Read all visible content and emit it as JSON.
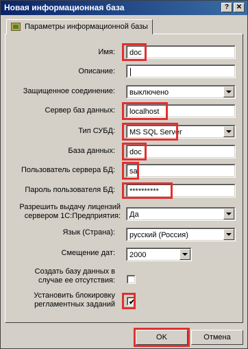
{
  "window": {
    "title": "Новая информационная база",
    "help": "?",
    "close": "✕"
  },
  "tab": {
    "label": "Параметры информационной базы"
  },
  "form": {
    "name": {
      "label": "Имя:",
      "value": "doc"
    },
    "description": {
      "label": "Описание:",
      "value": ""
    },
    "secure_connection": {
      "label": "Защищенное соединение:",
      "value": "выключено"
    },
    "db_server": {
      "label": "Сервер баз данных:",
      "value": "localhost"
    },
    "dbms_type": {
      "label": "Тип СУБД:",
      "value": "MS SQL Server"
    },
    "database": {
      "label": "База данных:",
      "value": "doc"
    },
    "db_user": {
      "label": "Пользователь сервера БД:",
      "value": "sa"
    },
    "db_password": {
      "label": "Пароль пользователя БД:",
      "value": "**********"
    },
    "licenses": {
      "label_line1": "Разрешить выдачу лицензий",
      "label_line2": "сервером 1С:Предприятия:",
      "value": "Да"
    },
    "language": {
      "label": "Язык (Страна):",
      "value": "русский (Россия)"
    },
    "date_offset": {
      "label": "Смещение дат:",
      "value": "2000"
    },
    "create_db": {
      "label_line1": "Создать базу данных в",
      "label_line2": "случае ее отсутствия:",
      "checked": false
    },
    "block_jobs": {
      "label_line1": "Установить блокировку",
      "label_line2": "регламентных заданий",
      "checked": true
    }
  },
  "buttons": {
    "ok": "OK",
    "cancel": "Отмена"
  },
  "colors": {
    "highlight": "#e03030",
    "titlebar": "#0a246a"
  }
}
